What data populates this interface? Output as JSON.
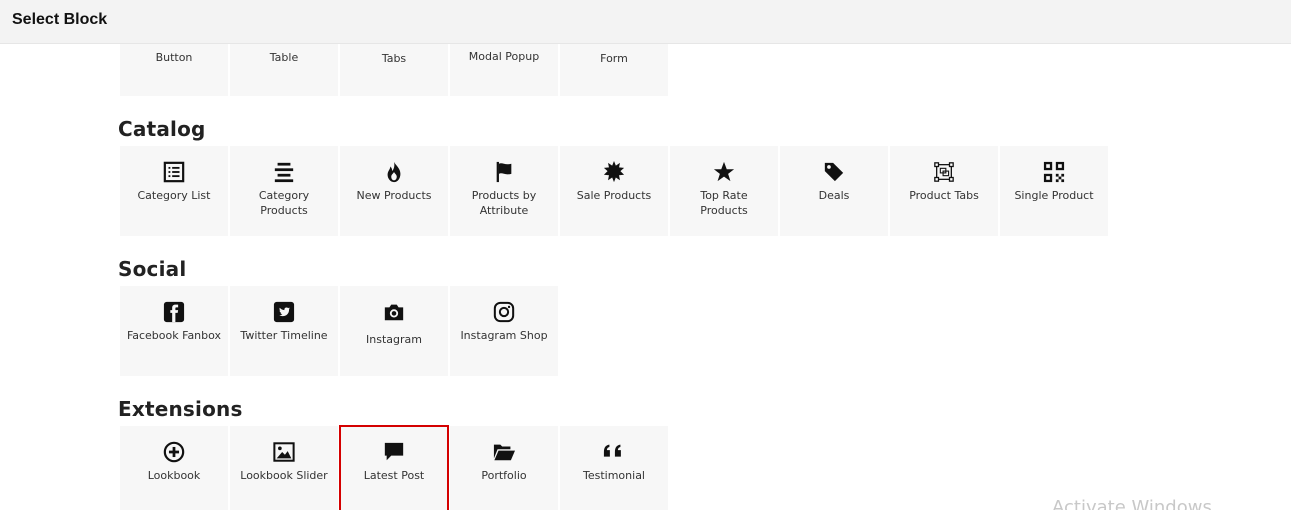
{
  "header": {
    "title": "Select Block"
  },
  "top_row": [
    {
      "label": "Button"
    },
    {
      "label": "Table"
    },
    {
      "label": "Tabs"
    },
    {
      "label": "Modal Popup"
    },
    {
      "label": "Form"
    }
  ],
  "catalog": {
    "title": "Catalog",
    "items": [
      {
        "label": "Category List",
        "icon": "list-icon"
      },
      {
        "label": "Category Products",
        "icon": "align-center-icon"
      },
      {
        "label": "New Products",
        "icon": "fire-icon"
      },
      {
        "label": "Products by Attribute",
        "icon": "flag-icon"
      },
      {
        "label": "Sale Products",
        "icon": "burst-icon"
      },
      {
        "label": "Top Rate Products",
        "icon": "star-icon"
      },
      {
        "label": "Deals",
        "icon": "tag-icon"
      },
      {
        "label": "Product Tabs",
        "icon": "object-group-icon"
      },
      {
        "label": "Single Product",
        "icon": "qrcode-icon"
      }
    ]
  },
  "social": {
    "title": "Social",
    "items": [
      {
        "label": "Facebook Fanbox",
        "icon": "facebook-icon"
      },
      {
        "label": "Twitter Timeline",
        "icon": "twitter-icon"
      },
      {
        "label": "Instagram",
        "icon": "camera-icon"
      },
      {
        "label": "Instagram Shop",
        "icon": "instagram-icon"
      }
    ]
  },
  "extensions": {
    "title": "Extensions",
    "items": [
      {
        "label": "Lookbook",
        "icon": "plus-circle-icon"
      },
      {
        "label": "Lookbook Slider",
        "icon": "image-icon"
      },
      {
        "label": "Latest Post",
        "icon": "comment-icon",
        "selected": true
      },
      {
        "label": "Portfolio",
        "icon": "folder-open-icon"
      },
      {
        "label": "Testimonial",
        "icon": "quote-icon"
      }
    ]
  },
  "watermark": {
    "text": "Activate Windows"
  },
  "colors": {
    "selected_border": "#d40000",
    "tile_bg": "#f7f7f7",
    "header_bg": "#f3f3f3"
  }
}
